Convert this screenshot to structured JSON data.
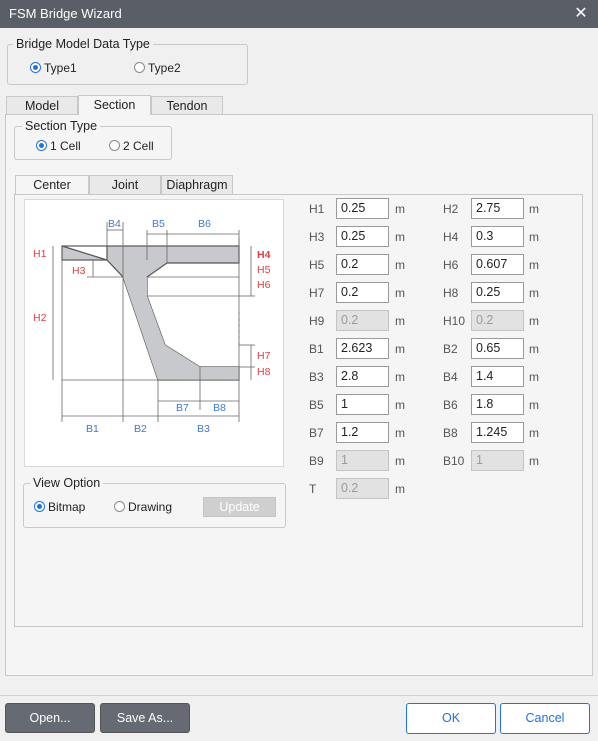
{
  "window": {
    "title": "FSM Bridge Wizard",
    "close_symbol": "✕"
  },
  "model_data_type": {
    "legend": "Bridge Model Data Type",
    "options": [
      "Type1",
      "Type2"
    ],
    "selected": "Type1"
  },
  "tabs": [
    "Model",
    "Section",
    "Tendon"
  ],
  "active_tab": "Section",
  "section_type": {
    "legend": "Section Type",
    "options": [
      "1 Cell",
      "2 Cell"
    ],
    "selected": "1 Cell"
  },
  "subtabs": [
    "Center",
    "Joint",
    "Diaphragm"
  ],
  "active_subtab": "Center",
  "diagram": {
    "labels": {
      "H1": "H1",
      "H2": "H2",
      "H3": "H3",
      "H4": "H4",
      "H5": "H5",
      "H6": "H6",
      "H7": "H7",
      "H8": "H8",
      "B1": "B1",
      "B2": "B2",
      "B3": "B3",
      "B4": "B4",
      "B5": "B5",
      "B6": "B6",
      "B7": "B7",
      "B8": "B8"
    },
    "colors": {
      "h_labels": "#e04040",
      "b_labels": "#3a7bd5",
      "section_fill": "#c8c9cc"
    }
  },
  "view_option": {
    "legend": "View Option",
    "options": [
      "Bitmap",
      "Drawing"
    ],
    "selected": "Bitmap",
    "update_label": "Update"
  },
  "params": [
    {
      "label": "H1",
      "value": "0.25",
      "unit": "m",
      "disabled": false
    },
    {
      "label": "H2",
      "value": "2.75",
      "unit": "m",
      "disabled": false
    },
    {
      "label": "H3",
      "value": "0.25",
      "unit": "m",
      "disabled": false
    },
    {
      "label": "H4",
      "value": "0.3",
      "unit": "m",
      "disabled": false
    },
    {
      "label": "H5",
      "value": "0.2",
      "unit": "m",
      "disabled": false
    },
    {
      "label": "H6",
      "value": "0.607",
      "unit": "m",
      "disabled": false
    },
    {
      "label": "H7",
      "value": "0.2",
      "unit": "m",
      "disabled": false
    },
    {
      "label": "H8",
      "value": "0.25",
      "unit": "m",
      "disabled": false
    },
    {
      "label": "H9",
      "value": "0.2",
      "unit": "m",
      "disabled": true
    },
    {
      "label": "H10",
      "value": "0.2",
      "unit": "m",
      "disabled": true
    },
    {
      "label": "B1",
      "value": "2.623",
      "unit": "m",
      "disabled": false
    },
    {
      "label": "B2",
      "value": "0.65",
      "unit": "m",
      "disabled": false
    },
    {
      "label": "B3",
      "value": "2.8",
      "unit": "m",
      "disabled": false
    },
    {
      "label": "B4",
      "value": "1.4",
      "unit": "m",
      "disabled": false
    },
    {
      "label": "B5",
      "value": "1",
      "unit": "m",
      "disabled": false
    },
    {
      "label": "B6",
      "value": "1.8",
      "unit": "m",
      "disabled": false
    },
    {
      "label": "B7",
      "value": "1.2",
      "unit": "m",
      "disabled": false
    },
    {
      "label": "B8",
      "value": "1.245",
      "unit": "m",
      "disabled": false
    },
    {
      "label": "B9",
      "value": "1",
      "unit": "m",
      "disabled": true
    },
    {
      "label": "B10",
      "value": "1",
      "unit": "m",
      "disabled": true
    },
    {
      "label": "T",
      "value": "0.2",
      "unit": "m",
      "disabled": true
    }
  ],
  "footer": {
    "open": "Open...",
    "save_as": "Save As...",
    "ok": "OK",
    "cancel": "Cancel"
  }
}
